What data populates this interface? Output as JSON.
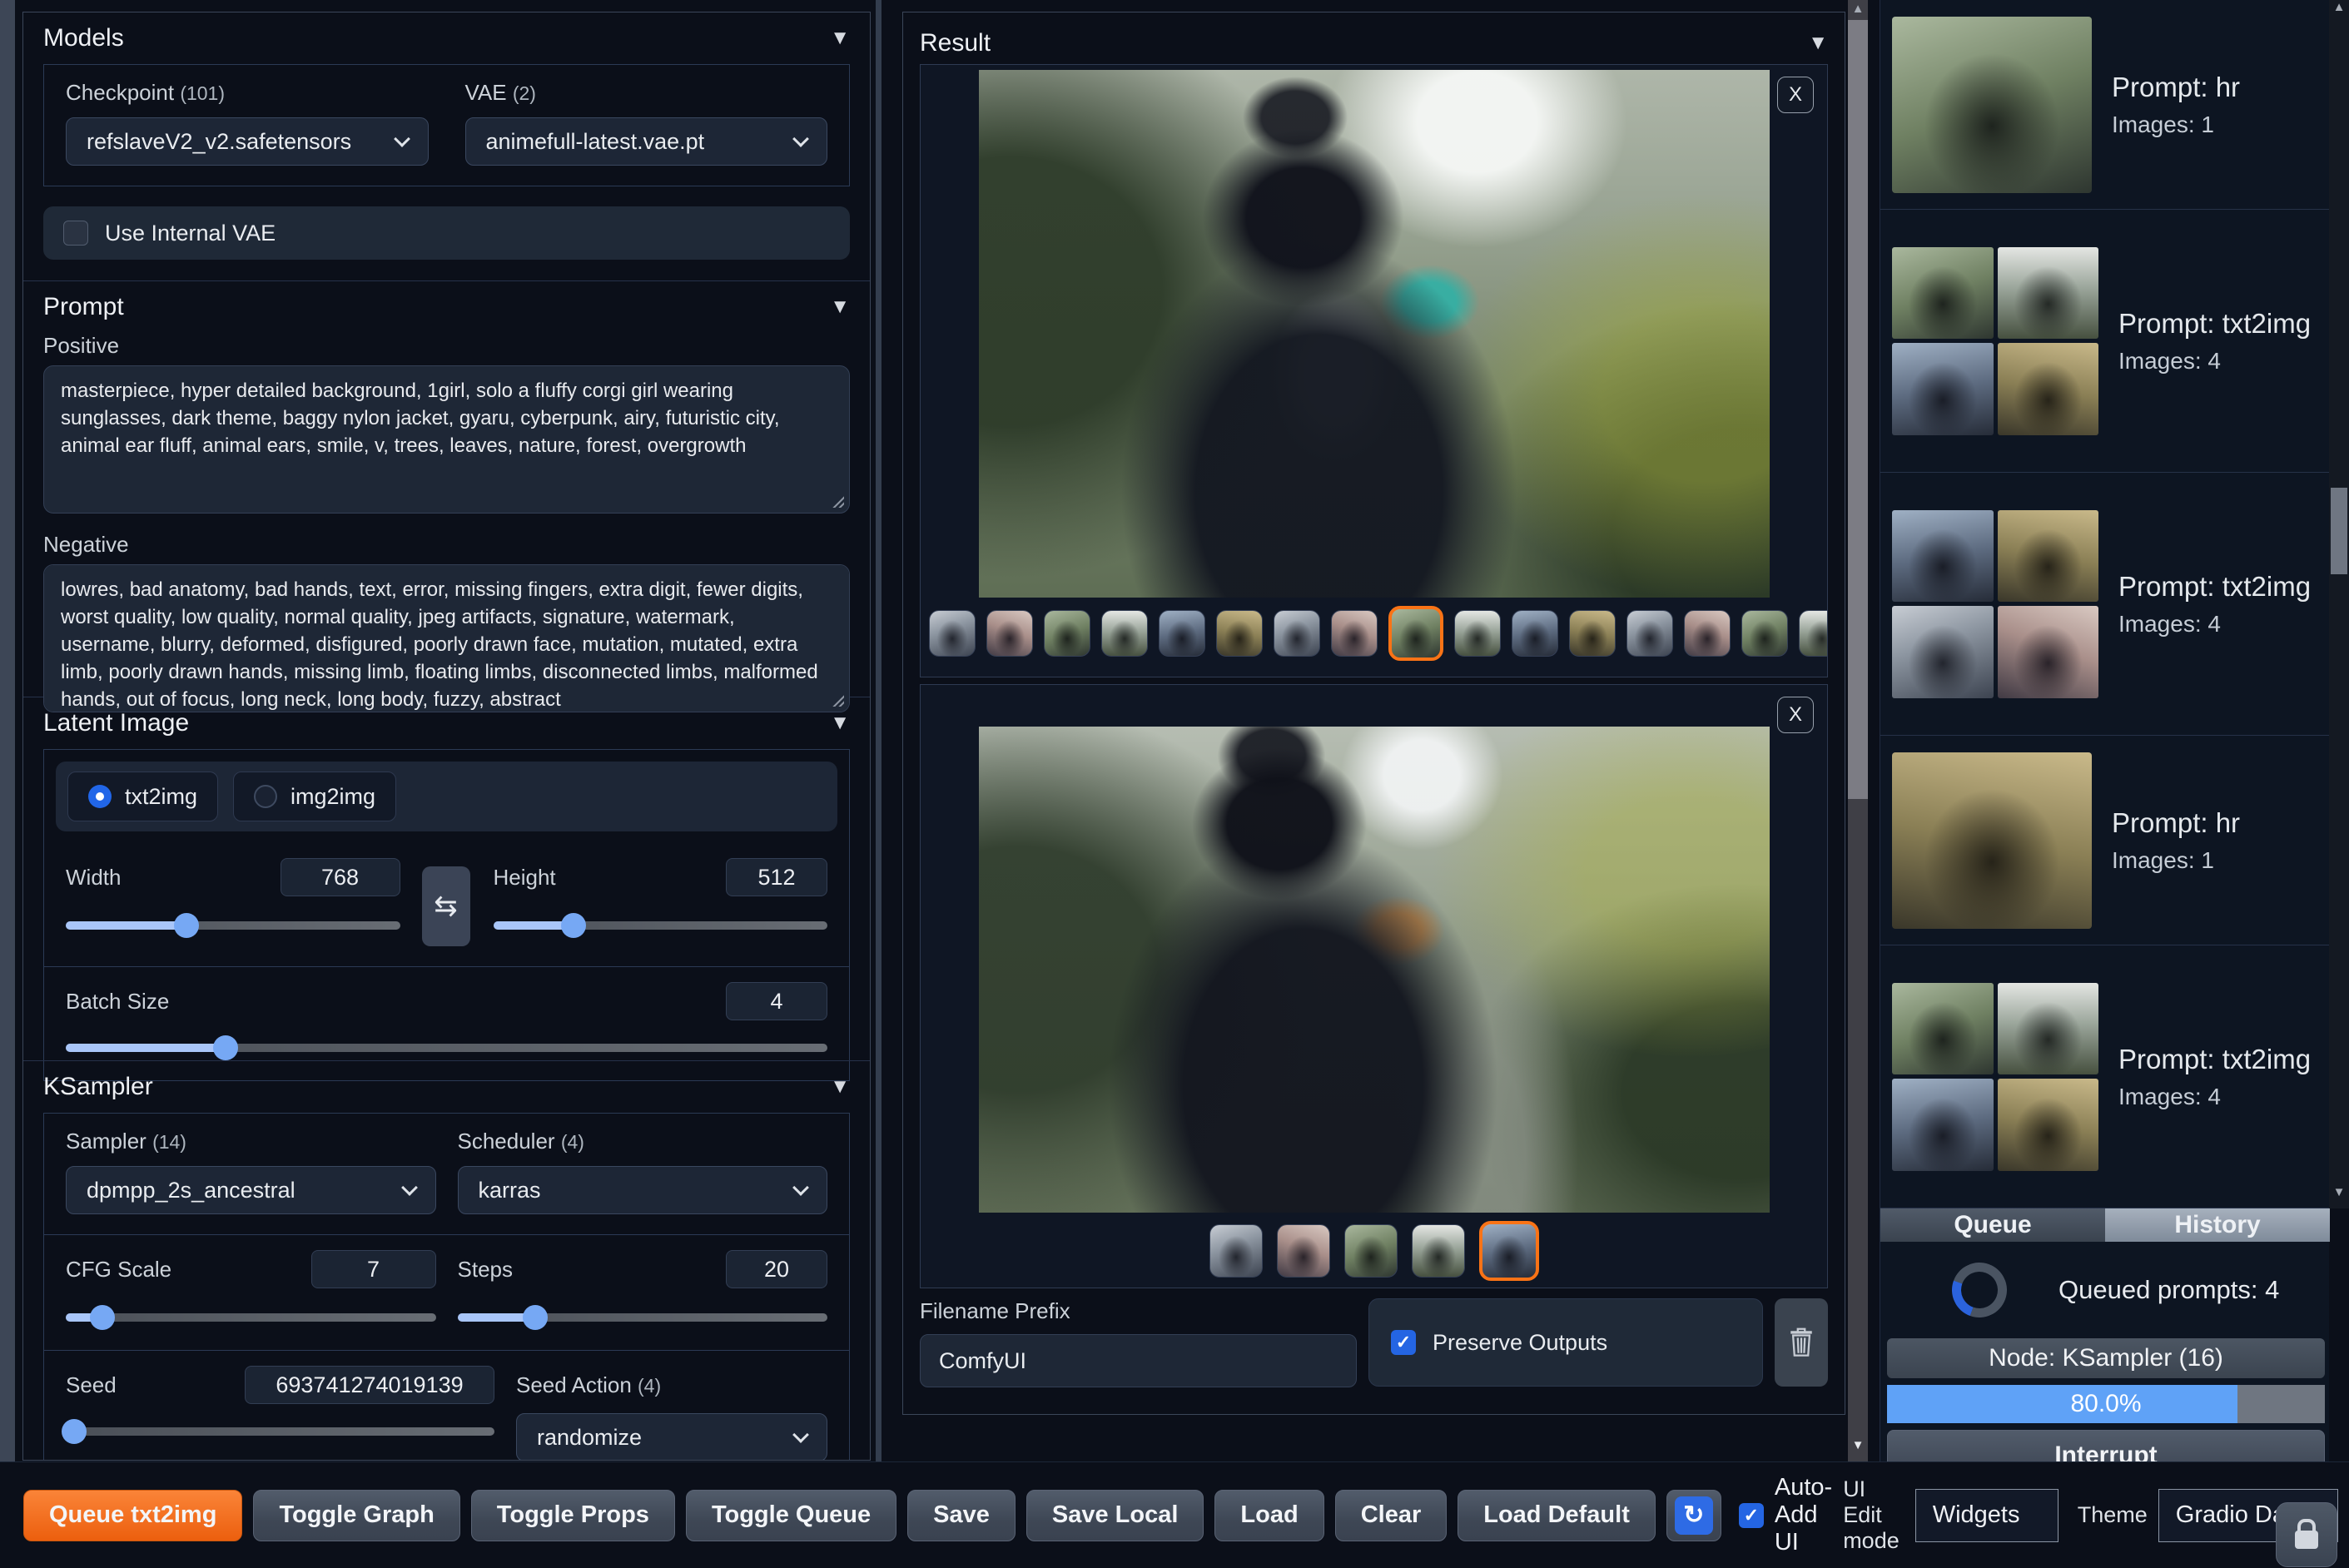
{
  "icons": {
    "collapse": "▼",
    "swap": "⇆",
    "refresh": "↻",
    "check": "✓",
    "close": "X",
    "scroll_up": "▲",
    "scroll_down": "▼"
  },
  "colors": {
    "accent_orange": "#f97316",
    "accent_blue": "#5fa2f7",
    "slider_blue": "#76a8f4"
  },
  "models": {
    "title": "Models",
    "checkpoint_label": "Checkpoint",
    "checkpoint_count": "(101)",
    "checkpoint_value": "refslaveV2_v2.safetensors",
    "vae_label": "VAE",
    "vae_count": "(2)",
    "vae_value": "animefull-latest.vae.pt",
    "use_internal_vae_label": "Use Internal VAE"
  },
  "prompt": {
    "title": "Prompt",
    "positive_label": "Positive",
    "positive_value": "masterpiece, hyper detailed background, 1girl, solo a fluffy corgi girl wearing sunglasses, dark theme, baggy nylon jacket, gyaru, cyberpunk, airy, futuristic city, animal ear fluff, animal ears, smile, v, trees, leaves, nature, forest, overgrowth",
    "negative_label": "Negative",
    "negative_value": "lowres, bad anatomy, bad hands, text, error, missing fingers, extra digit, fewer digits, worst quality, low quality, normal quality, jpeg artifacts, signature, watermark, username, blurry, deformed, disfigured, poorly drawn face, mutation, mutated, extra limb, poorly drawn hands, missing limb, floating limbs, disconnected limbs, malformed hands, out of focus, long neck, long body, fuzzy, abstract"
  },
  "latent": {
    "title": "Latent Image",
    "mode_txt2img": "txt2img",
    "mode_img2img": "img2img",
    "selected_mode": "txt2img",
    "width_label": "Width",
    "width": "768",
    "height_label": "Height",
    "height": "512",
    "batch_label": "Batch Size",
    "batch": "4",
    "width_pct": 36,
    "height_pct": 24,
    "batch_pct": 21
  },
  "ksampler": {
    "title": "KSampler",
    "sampler_label": "Sampler",
    "sampler_count": "(14)",
    "sampler_value": "dpmpp_2s_ancestral",
    "scheduler_label": "Scheduler",
    "scheduler_count": "(4)",
    "scheduler_value": "karras",
    "cfg_label": "CFG Scale",
    "cfg": "7",
    "cfg_pct": 10,
    "steps_label": "Steps",
    "steps": "20",
    "steps_pct": 21,
    "seed_label": "Seed",
    "seed": "693741274019139",
    "seed_pct": 2,
    "seed_action_label": "Seed Action",
    "seed_action_count": "(4)",
    "seed_action_value": "randomize"
  },
  "result": {
    "title": "Result",
    "gallery1": {
      "thumb_count": 17,
      "selected_index": 8
    },
    "gallery2": {
      "thumb_count": 5,
      "selected_index": 4
    },
    "filename_label": "Filename Prefix",
    "filename_value": "ComfyUI",
    "preserve_label": "Preserve Outputs"
  },
  "queue_panel": {
    "tab_queue": "Queue",
    "tab_history": "History",
    "active_tab": "History",
    "items": [
      {
        "prompt": "Prompt: hr",
        "images": "Images: 1",
        "type": "single"
      },
      {
        "prompt": "Prompt: txt2img",
        "images": "Images: 4",
        "type": "grid"
      },
      {
        "prompt": "Prompt: txt2img",
        "images": "Images: 4",
        "type": "grid"
      },
      {
        "prompt": "Prompt: hr",
        "images": "Images: 1",
        "type": "single"
      },
      {
        "prompt": "Prompt: txt2img",
        "images": "Images: 4",
        "type": "grid"
      }
    ],
    "queued_text": "Queued prompts: 4",
    "node_text": "Node: KSampler (16)",
    "progress_text": "80.0%",
    "progress_pct": 80,
    "interrupt_label": "Interrupt"
  },
  "bottombar": {
    "queue_button": "Queue txt2img",
    "buttons": [
      "Toggle Graph",
      "Toggle Props",
      "Toggle Queue",
      "Save",
      "Save Local",
      "Load",
      "Clear",
      "Load Default"
    ],
    "auto_add_label": "Auto-Add UI",
    "ui_edit_label": "UI Edit mode",
    "widgets_value": "Widgets",
    "theme_label": "Theme",
    "theme_value": "Gradio Dark"
  }
}
